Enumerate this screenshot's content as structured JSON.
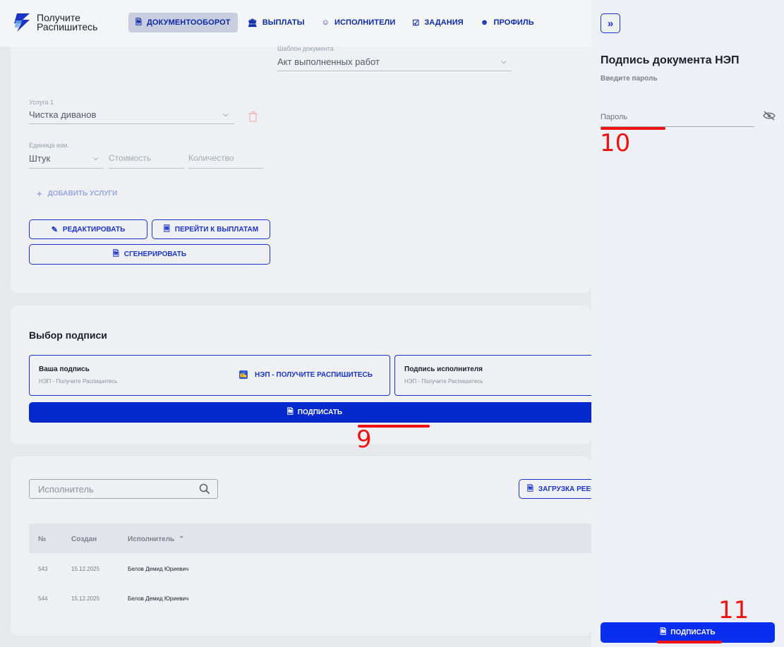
{
  "header": {
    "logo_line1": "Получите",
    "logo_line2": "Распишитесь",
    "nav": [
      {
        "label": "ДОКУМЕНТООБОРОТ",
        "icon": "document-icon",
        "active": true
      },
      {
        "label": "ВЫПЛАТЫ",
        "icon": "bank-icon"
      },
      {
        "label": "ИСПОЛНИТЕЛИ",
        "icon": "users-icon"
      },
      {
        "label": "ЗАДАНИЯ",
        "icon": "calendar-check-icon"
      },
      {
        "label": "ПРОФИЛЬ",
        "icon": "user-icon"
      }
    ]
  },
  "form": {
    "template_label": "Шаблон документа",
    "template_value": "Акт выполненных работ",
    "service_label": "Услуга 1",
    "service_value": "Чистка диванов",
    "unit_label": "Единица изм.",
    "unit_value": "Штук",
    "cost_placeholder": "Стоимость",
    "qty_placeholder": "Количество",
    "add_service": "ДОБАВИТЬ УСЛУГИ",
    "edit_button": "РЕДАКТИРОВАТЬ",
    "payments_button": "ПЕРЕЙТИ К ВЫПЛАТАМ",
    "generate_button": "СГЕНЕРИРОВАТЬ"
  },
  "signature": {
    "title": "Выбор подписи",
    "your_title": "Ваша подпись",
    "your_sub": "НЭП - Получите Распишитесь",
    "nep_link": "НЭП - ПОЛУЧИТЕ РАСПИШИТЕСЬ",
    "executor_title": "Подпись исполнителя",
    "executor_sub": "НЭП - Получите Распишитесь",
    "sign_button": "ПОДПИСАТЬ"
  },
  "registry": {
    "search_placeholder": "Исполнитель",
    "upload_button": "ЗАГРУЗКА РЕЕС",
    "columns": [
      "№",
      "Создан",
      "Исполнитель"
    ],
    "rows": [
      {
        "num": "543",
        "created": "15.12.2025",
        "executor": "Белов Демид Юриевич"
      },
      {
        "num": "544",
        "created": "15.12.2025",
        "executor": "Белов Демид Юриевич"
      }
    ]
  },
  "panel": {
    "title": "Подпись документа НЭП",
    "subtitle": "Введите пароль",
    "password_label": "Пароль",
    "sign_button": "ПОДПИСАТЬ"
  },
  "annotations": {
    "a9": "9",
    "a10": "10",
    "a11": "11"
  },
  "colors": {
    "accent": "#0328cc",
    "annotation": "#ee1212"
  }
}
